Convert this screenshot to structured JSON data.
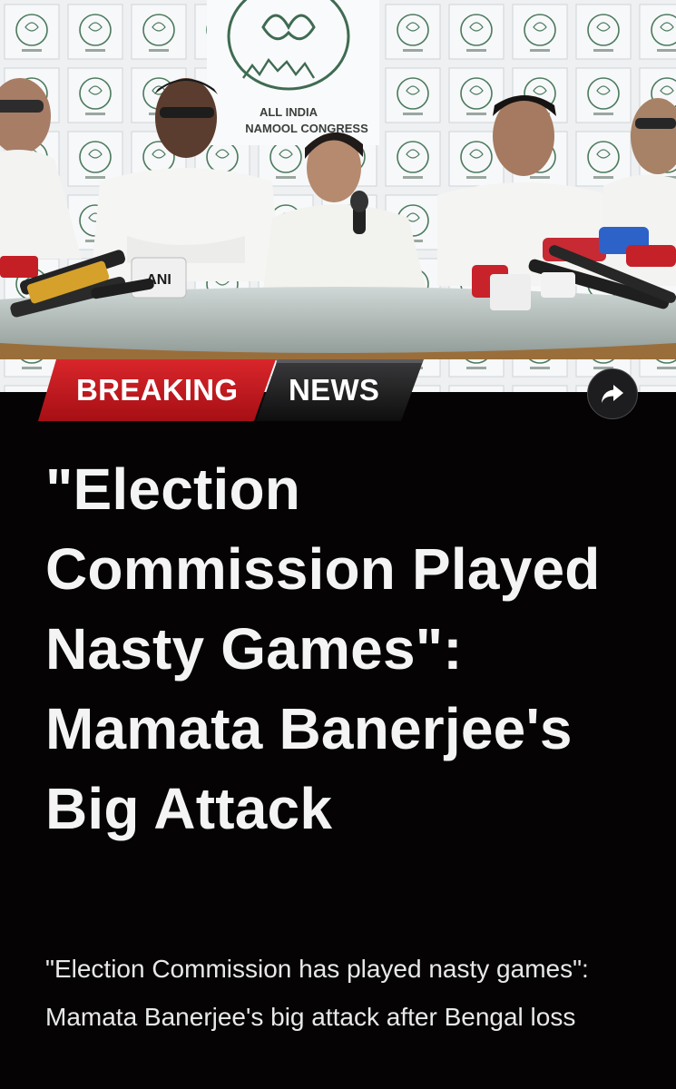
{
  "photo": {
    "alt_scene": "press-conference",
    "backdrop_text_line1": "ALL INDIA",
    "backdrop_text_line2": "NAMOOL CONGRESS",
    "mic_label_left": "ANI"
  },
  "badge": {
    "red_label": "BREAKING",
    "dark_label": "NEWS",
    "red_color": "#c0171c",
    "dark_color": "#1a1a1a"
  },
  "share": {
    "icon": "share-arrow-icon"
  },
  "article": {
    "headline": "\"Election Commission Played Nasty Games\": Mamata Banerjee's Big Attack",
    "summary": "\"Election Commission has played nasty games\": Mamata Banerjee's big attack after Bengal loss"
  },
  "colors": {
    "background": "#050304",
    "headline_text": "#f4f4f4",
    "summary_text": "#e8e8e8"
  }
}
